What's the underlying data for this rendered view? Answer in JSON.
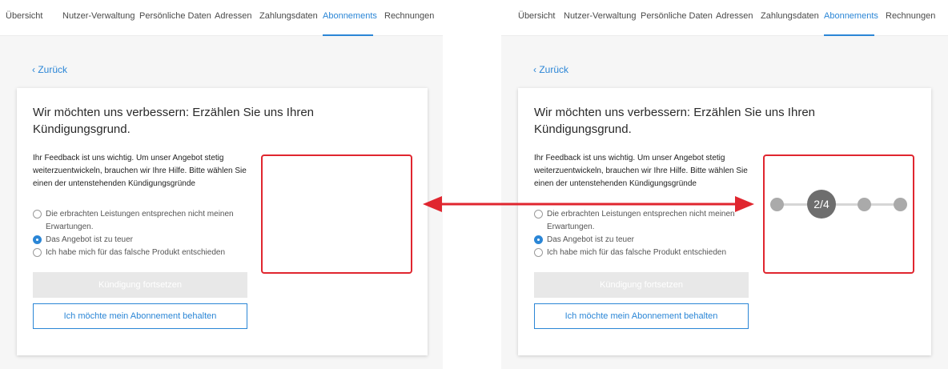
{
  "nav": {
    "tabs": [
      {
        "label": "Übersicht"
      },
      {
        "label": "Nutzer-Verwaltung"
      },
      {
        "label": "Persönliche Daten"
      },
      {
        "label": "Adressen"
      },
      {
        "label": "Zahlungsdaten"
      },
      {
        "label": "Abonnements",
        "active": true
      },
      {
        "label": "Rechnungen"
      }
    ]
  },
  "back_link": "Zurück",
  "card": {
    "heading": "Wir möchten uns verbessern: Erzählen Sie uns Ihren Kündigungsgrund.",
    "intro": "Ihr Feedback ist uns wichtig. Um unser Angebot stetig weiterzuentwickeln, brauchen wir Ihre Hilfe. Bitte wählen Sie einen der untenstehenden Kündigungsgründe",
    "options": [
      {
        "label": "Die erbrachten Leistungen entsprechen nicht meinen Erwartungen.",
        "selected": false
      },
      {
        "label": "Das Angebot ist zu teuer",
        "selected": true
      },
      {
        "label": "Ich habe mich für das falsche Produkt entschieden",
        "selected": false
      }
    ],
    "continue_button": "Kündigung fortsetzen",
    "keep_button": "Ich möchte mein Abonnement behalten"
  },
  "stepper": {
    "current_label": "2/4",
    "current_step": 2,
    "total_steps": 4
  },
  "colors": {
    "accent": "#2b86d6",
    "highlight": "#e0262f",
    "background": "#f6f6f6"
  }
}
